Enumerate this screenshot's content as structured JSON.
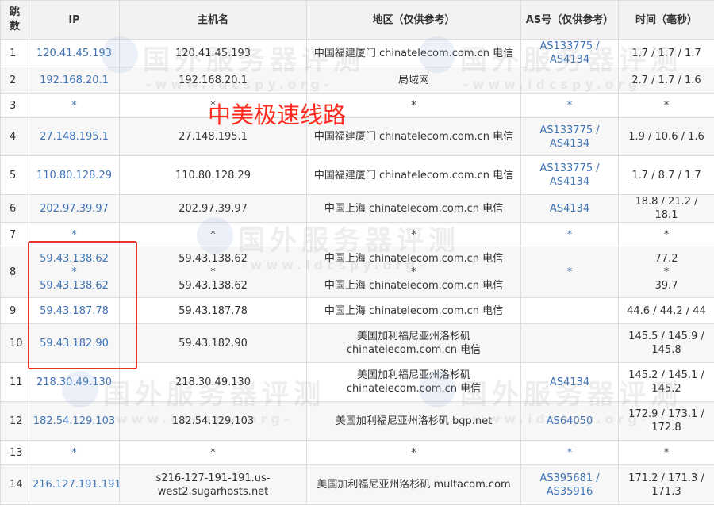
{
  "headers": {
    "hop": "跳数",
    "ip": "IP",
    "hostname": "主机名",
    "region": "地区（仅供参考）",
    "as": "AS号（仅供参考）",
    "time": "时间（毫秒）"
  },
  "rows": [
    {
      "hop": "1",
      "ip": [
        "120.41.45.193"
      ],
      "host": [
        "120.41.45.193"
      ],
      "region": [
        "中国福建厦门 chinatelecom.com.cn 电信"
      ],
      "as": [
        "AS133775 /",
        "AS4134"
      ],
      "time": [
        "1.7 / 1.7 / 1.7"
      ]
    },
    {
      "hop": "2",
      "ip": [
        "192.168.20.1"
      ],
      "host": [
        "192.168.20.1"
      ],
      "region": [
        "局域网"
      ],
      "as": [],
      "time": [
        "2.7 / 1.7 / 1.6"
      ]
    },
    {
      "hop": "3",
      "ip": [
        "*"
      ],
      "host": [
        "*"
      ],
      "region": [
        "*"
      ],
      "as": [
        "*"
      ],
      "time": [
        "*"
      ]
    },
    {
      "hop": "4",
      "ip": [
        "27.148.195.1"
      ],
      "host": [
        "27.148.195.1"
      ],
      "region": [
        "中国福建厦门 chinatelecom.com.cn 电信"
      ],
      "as": [
        "AS133775 /",
        "AS4134"
      ],
      "time": [
        "1.9 / 10.6 / 1.6"
      ]
    },
    {
      "hop": "5",
      "ip": [
        "110.80.128.29"
      ],
      "host": [
        "110.80.128.29"
      ],
      "region": [
        "中国福建厦门 chinatelecom.com.cn 电信"
      ],
      "as": [
        "AS133775 /",
        "AS4134"
      ],
      "time": [
        "1.7 / 8.7 / 1.7"
      ]
    },
    {
      "hop": "6",
      "ip": [
        "202.97.39.97"
      ],
      "host": [
        "202.97.39.97"
      ],
      "region": [
        "中国上海 chinatelecom.com.cn 电信"
      ],
      "as": [
        "AS4134"
      ],
      "time": [
        "18.8 / 21.2 / 18.1"
      ]
    },
    {
      "hop": "7",
      "ip": [
        "*"
      ],
      "host": [
        "*"
      ],
      "region": [
        "*"
      ],
      "as": [
        "*"
      ],
      "time": [
        "*"
      ]
    },
    {
      "hop": "8",
      "ip": [
        "59.43.138.62",
        "*",
        "59.43.138.62"
      ],
      "host": [
        "59.43.138.62",
        "*",
        "59.43.138.62"
      ],
      "region": [
        "中国上海 chinatelecom.com.cn 电信",
        "*",
        "中国上海 chinatelecom.com.cn 电信"
      ],
      "as": [
        "*"
      ],
      "time": [
        "77.2",
        "*",
        "39.7"
      ]
    },
    {
      "hop": "9",
      "ip": [
        "59.43.187.78"
      ],
      "host": [
        "59.43.187.78"
      ],
      "region": [
        "中国上海 chinatelecom.com.cn 电信"
      ],
      "as": [],
      "time": [
        "44.6 / 44.2 / 44"
      ]
    },
    {
      "hop": "10",
      "ip": [
        "59.43.182.90"
      ],
      "host": [
        "59.43.182.90"
      ],
      "region": [
        "美国加利福尼亚州洛杉矶",
        "chinatelecom.com.cn 电信"
      ],
      "as": [],
      "time": [
        "145.5 / 145.9 /",
        "145.8"
      ]
    },
    {
      "hop": "11",
      "ip": [
        "218.30.49.130"
      ],
      "host": [
        "218.30.49.130"
      ],
      "region": [
        "美国加利福尼亚州洛杉矶",
        "chinatelecom.com.cn 电信"
      ],
      "as": [
        "AS4134"
      ],
      "time": [
        "145.2 / 145.1 /",
        "145.2"
      ]
    },
    {
      "hop": "12",
      "ip": [
        "182.54.129.103"
      ],
      "host": [
        "182.54.129.103"
      ],
      "region": [
        "美国加利福尼亚州洛杉矶 bgp.net"
      ],
      "as": [
        "AS64050"
      ],
      "time": [
        "172.9 / 173.1 /",
        "172.8"
      ]
    },
    {
      "hop": "13",
      "ip": [
        "*"
      ],
      "host": [
        "*"
      ],
      "region": [
        "*"
      ],
      "as": [
        "*"
      ],
      "time": [
        "*"
      ]
    },
    {
      "hop": "14",
      "ip": [
        "216.127.191.191"
      ],
      "host": [
        "s216-127-191-191.us-",
        "west2.sugarhosts.net"
      ],
      "region": [
        "美国加利福尼亚州洛杉矶 multacom.com"
      ],
      "as": [
        "AS395681 /",
        "AS35916"
      ],
      "time": [
        "171.2 / 171.3 /",
        "171.3"
      ]
    }
  ],
  "annotation": "中美极速线路",
  "watermark": {
    "title": "国外服务器评测",
    "url": "-www.idcspy.org-"
  },
  "colors": {
    "link": "#3f73b5",
    "annotation": "#ff2a1f",
    "box": "#e8332b",
    "header_bg": "#f2f2f2"
  }
}
